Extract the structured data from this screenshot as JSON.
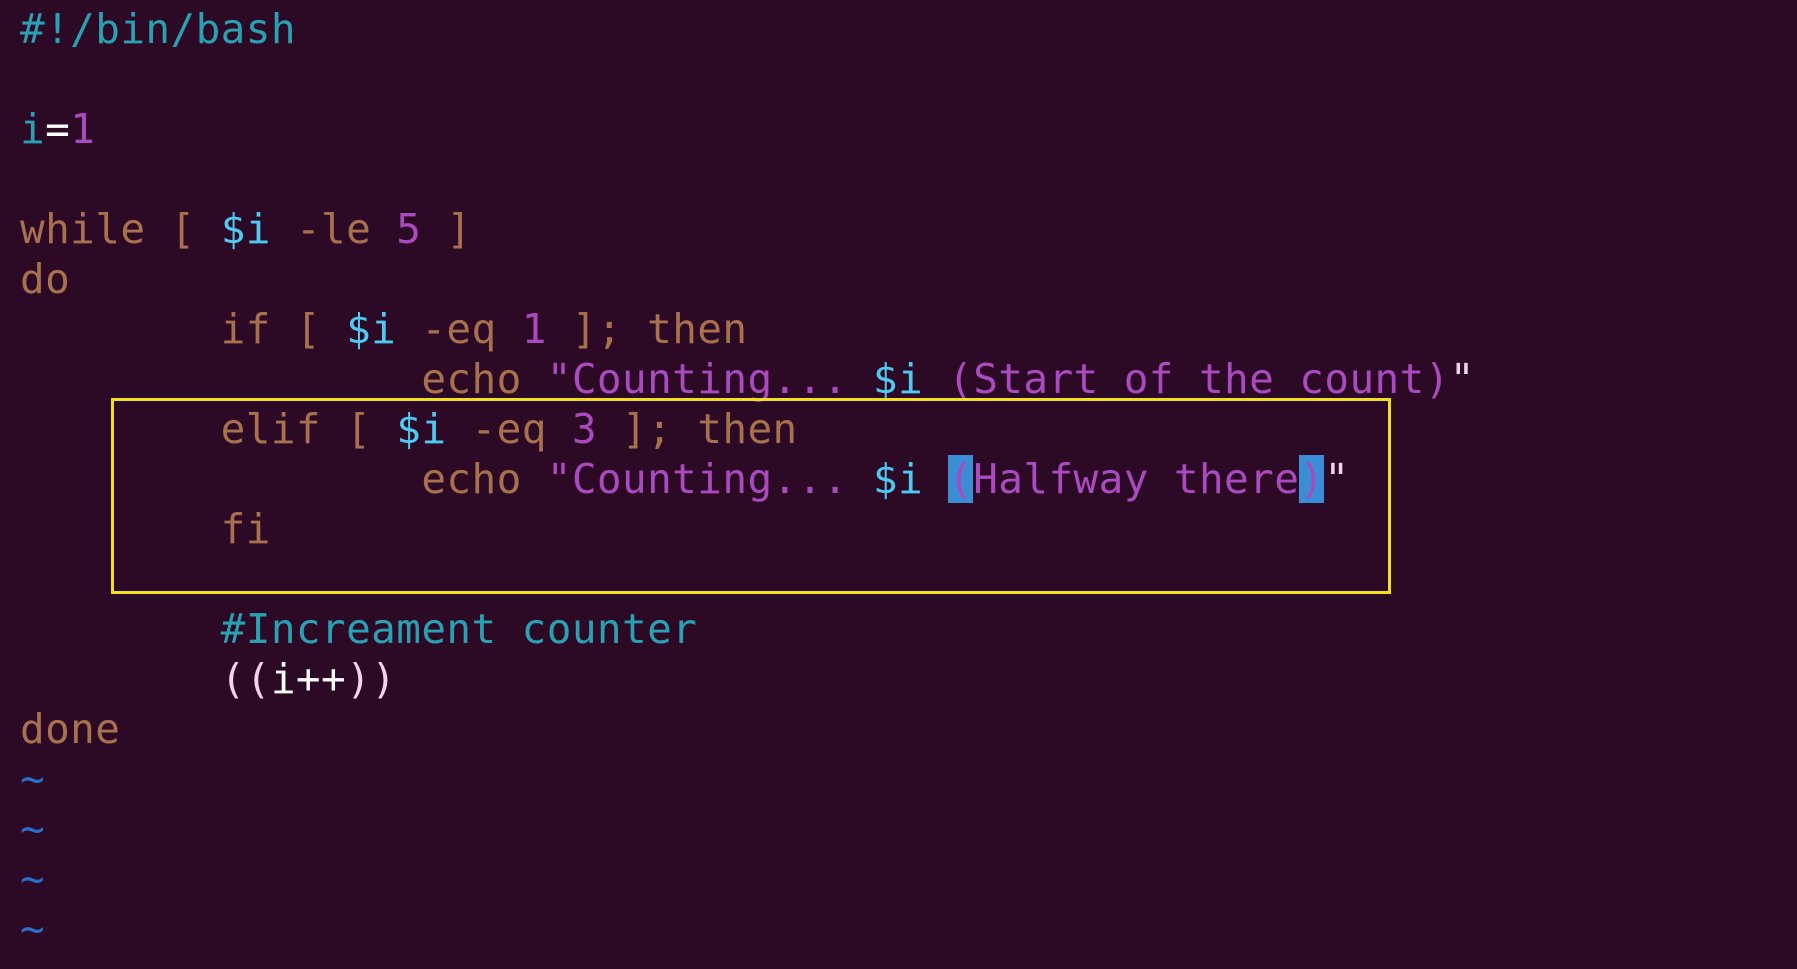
{
  "editor": {
    "lines": [
      [
        {
          "t": "#!/bin/bash",
          "c": "shebang"
        }
      ],
      [],
      [
        {
          "t": "i",
          "c": "var"
        },
        {
          "t": "=",
          "c": "op"
        },
        {
          "t": "1",
          "c": "num"
        }
      ],
      [],
      [
        {
          "t": "while",
          "c": "kw"
        },
        {
          "t": " [ ",
          "c": "kw"
        },
        {
          "t": "$i",
          "c": "param"
        },
        {
          "t": " -le ",
          "c": "kw"
        },
        {
          "t": "5",
          "c": "num"
        },
        {
          "t": " ]",
          "c": "kw"
        }
      ],
      [
        {
          "t": "do",
          "c": "kw"
        }
      ],
      [
        {
          "t": "        if [ ",
          "c": "kw"
        },
        {
          "t": "$i",
          "c": "param"
        },
        {
          "t": " -eq ",
          "c": "kw"
        },
        {
          "t": "1",
          "c": "num"
        },
        {
          "t": " ]; then",
          "c": "kw"
        }
      ],
      [
        {
          "t": "                echo ",
          "c": "kw"
        },
        {
          "t": "\"Counting... ",
          "c": "str"
        },
        {
          "t": "$i",
          "c": "param"
        },
        {
          "t": " (Start of the count)",
          "c": "str"
        },
        {
          "t": "\"",
          "c": "paren"
        }
      ],
      [
        {
          "t": "        elif [ ",
          "c": "kw"
        },
        {
          "t": "$i",
          "c": "param"
        },
        {
          "t": " -eq ",
          "c": "kw"
        },
        {
          "t": "3",
          "c": "num"
        },
        {
          "t": " ]; then",
          "c": "kw"
        }
      ],
      [
        {
          "t": "                echo ",
          "c": "kw"
        },
        {
          "t": "\"Counting... ",
          "c": "str"
        },
        {
          "t": "$i",
          "c": "param"
        },
        {
          "t": " ",
          "c": "str"
        },
        {
          "t": "(",
          "c": "match"
        },
        {
          "t": "Halfway there",
          "c": "str"
        },
        {
          "t": ")",
          "c": "match"
        },
        {
          "t": "\"",
          "c": "paren"
        }
      ],
      [
        {
          "t": "        fi",
          "c": "kw"
        }
      ],
      [],
      [
        {
          "t": "        #Increament counter",
          "c": "comment"
        }
      ],
      [
        {
          "t": "        ((",
          "c": "paren"
        },
        {
          "t": "i++",
          "c": "plain"
        },
        {
          "t": "))",
          "c": "paren"
        }
      ],
      [
        {
          "t": "done",
          "c": "kw"
        }
      ],
      [
        {
          "t": "~",
          "c": "tilde"
        }
      ],
      [
        {
          "t": "~",
          "c": "tilde"
        }
      ],
      [
        {
          "t": "~",
          "c": "tilde"
        }
      ],
      [
        {
          "t": "~",
          "c": "tilde"
        }
      ]
    ]
  },
  "colors": {
    "background": "#2c0a26",
    "highlight_box": "#f2e11a",
    "keyword": "#a8714e",
    "string": "#a94bbf",
    "parameter": "#4fc9f0",
    "comment": "#2aa1b3",
    "bracket_match": "#3b8ed6"
  }
}
